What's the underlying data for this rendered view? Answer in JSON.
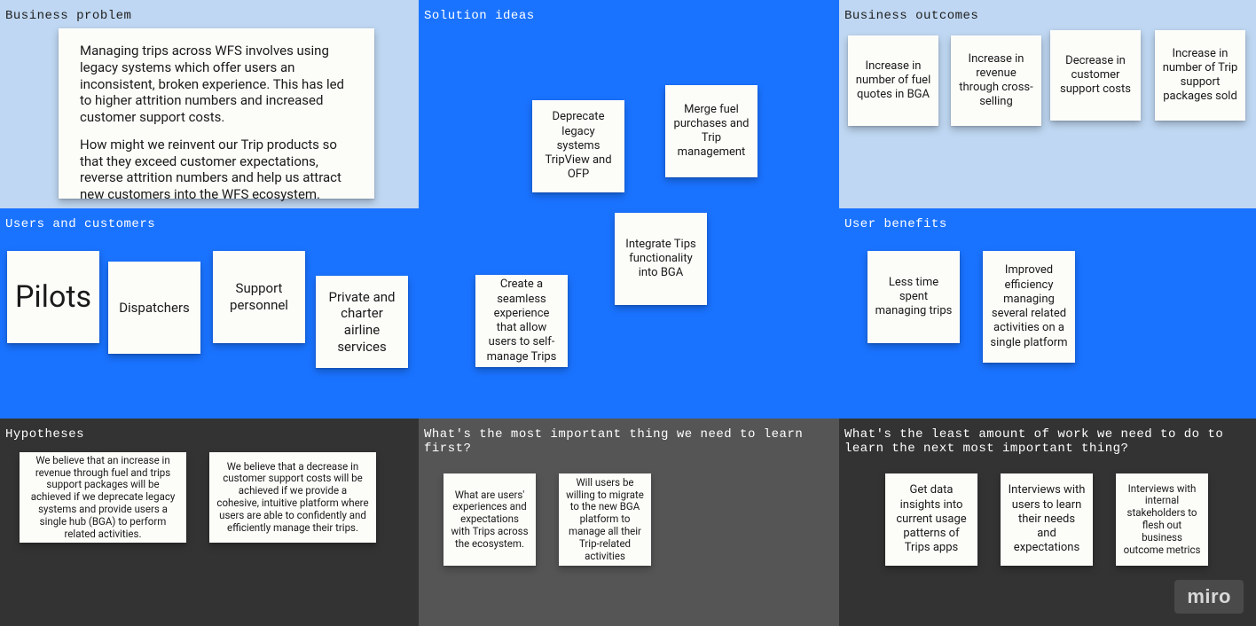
{
  "sections": {
    "business_problem": {
      "label": "Business problem",
      "note_p1": "Managing trips across WFS involves using legacy systems which offer users an inconsistent, broken experience. This has led to higher attrition numbers and increased customer support costs.",
      "note_p2": "How might we reinvent our Trip products so that they exceed customer expectations, reverse attrition numbers and help us attract new customers into the WFS ecosystem."
    },
    "solution_ideas": {
      "label": "Solution ideas",
      "notes": [
        "Deprecate legacy systems TripView and OFP",
        "Merge fuel purchases and Trip management",
        "Integrate Tips functionality into BGA",
        "Create a seamless experience that allow users to self-manage Trips"
      ]
    },
    "business_outcomes": {
      "label": "Business outcomes",
      "notes": [
        "Increase in number of fuel quotes in BGA",
        "Increase in revenue through cross-selling",
        "Decrease in customer support costs",
        "Increase in number of Trip support packages sold"
      ]
    },
    "users_customers": {
      "label": "Users and customers",
      "notes": [
        "Pilots",
        "Dispatchers",
        "Support personnel",
        "Private and charter airline services"
      ]
    },
    "user_benefits": {
      "label": "User benefits",
      "notes": [
        "Less time spent managing trips",
        "Improved efficiency managing several related activities on a single platform"
      ]
    },
    "hypotheses": {
      "label": "Hypotheses",
      "notes": [
        "We believe that an increase in revenue through fuel and trips support packages will be achieved if we deprecate legacy systems and provide users a single hub (BGA) to perform related activities.",
        "We believe that a decrease in customer support costs will be achieved if we provide a cohesive, intuitive platform where users are able to confidently and efficiently manage their trips."
      ]
    },
    "learn_first": {
      "label": "What's the most important thing we need to learn first?",
      "notes": [
        "What are users' experiences and expectations with Trips across the ecosystem.",
        "Will users be willing to migrate to the new BGA platform to manage all their Trip-related activities"
      ]
    },
    "least_work": {
      "label": "What's the least amount of work we need to do to learn the next most important thing?",
      "notes": [
        "Get data insights into current usage patterns of Trips apps",
        "Interviews with users to learn their needs and expectations",
        "Interviews with internal stakeholders to flesh out business outcome metrics"
      ]
    }
  },
  "branding": {
    "logo": "miro"
  }
}
